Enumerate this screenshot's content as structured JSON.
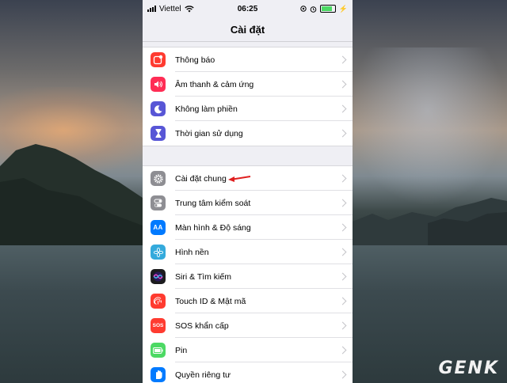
{
  "status_bar": {
    "carrier": "Viettel",
    "time": "06:25",
    "battery_level": 0.75
  },
  "nav": {
    "title": "Cài đặt"
  },
  "group1": [
    {
      "label": "Thông báo",
      "icon": "notification-icon",
      "color": "#ff3b30"
    },
    {
      "label": "Âm thanh & cảm ứng",
      "icon": "speaker-icon",
      "color": "#ff2d55"
    },
    {
      "label": "Không làm phiền",
      "icon": "moon-icon",
      "color": "#5856d6"
    },
    {
      "label": "Thời gian sử dụng",
      "icon": "hourglass-icon",
      "color": "#5856d6"
    }
  ],
  "group2": [
    {
      "label": "Cài đặt chung",
      "icon": "gear-icon",
      "color": "#8e8e93"
    },
    {
      "label": "Trung tâm kiểm soát",
      "icon": "toggles-icon",
      "color": "#8e8e93"
    },
    {
      "label": "Màn hình & Độ sáng",
      "icon": "text-size-icon",
      "color": "#007aff"
    },
    {
      "label": "Hình nền",
      "icon": "flower-icon",
      "color": "#34aadc"
    },
    {
      "label": "Siri & Tìm kiếm",
      "icon": "siri-icon",
      "color": "#1c1c1e"
    },
    {
      "label": "Touch ID & Mật mã",
      "icon": "fingerprint-icon",
      "color": "#ff3b30"
    },
    {
      "label": "SOS khẩn cấp",
      "icon": "sos-icon",
      "color": "#ff3b30"
    },
    {
      "label": "Pin",
      "icon": "battery-icon",
      "color": "#4cd964"
    },
    {
      "label": "Quyền riêng tư",
      "icon": "hand-icon",
      "color": "#007aff"
    }
  ],
  "icon_text": {
    "sos": "SOS",
    "text_size": "AA"
  },
  "watermark": {
    "logo": "GENK"
  }
}
